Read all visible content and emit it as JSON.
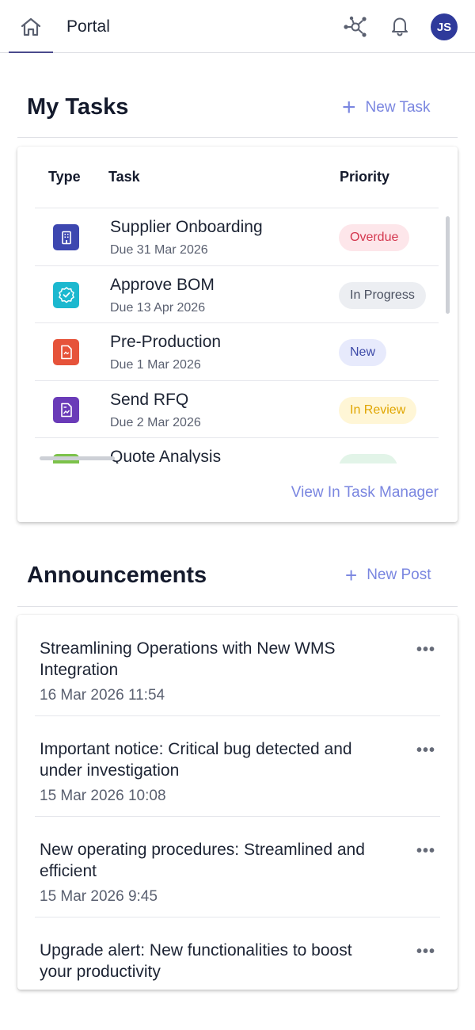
{
  "header": {
    "portal_title": "Portal",
    "avatar_initials": "JS",
    "icons": [
      "home-icon",
      "network-icon",
      "bell-icon"
    ]
  },
  "tasks_section": {
    "title": "My Tasks",
    "new_label": "New Task",
    "columns": {
      "type": "Type",
      "task": "Task",
      "priority": "Priority"
    },
    "rows": [
      {
        "name": "Supplier Onboarding",
        "due": "Due 31 Mar 2026",
        "status": "Overdue",
        "icon": "building-icon",
        "icon_color": "#3d47b0",
        "status_bg": "#fde6ea",
        "status_fg": "#d4374f"
      },
      {
        "name": "Approve BOM",
        "due": "Due 13 Apr 2026",
        "status": "In Progress",
        "icon": "check-badge-icon",
        "icon_color": "#1cb8cf",
        "status_bg": "#eceef2",
        "status_fg": "#4a5060"
      },
      {
        "name": "Pre-Production",
        "due": "Due 1 Mar 2026",
        "status": "New",
        "icon": "document-icon",
        "icon_color": "#e6533a",
        "status_bg": "#e7eafc",
        "status_fg": "#3d4aa8"
      },
      {
        "name": "Send RFQ",
        "due": "Due 2 Mar 2026",
        "status": "In Review",
        "icon": "document-chart-icon",
        "icon_color": "#6a3bb8",
        "status_bg": "#fff6d6",
        "status_fg": "#e0a500"
      },
      {
        "name": "Quote Analysis",
        "due": "",
        "status": "",
        "icon": "chart-icon",
        "icon_color": "#7cc24a",
        "status_bg": "#e2f4e8",
        "status_fg": "#2f8a4e"
      }
    ],
    "view_link": "View In Task Manager"
  },
  "announcements_section": {
    "title": "Announcements",
    "new_label": "New Post",
    "items": [
      {
        "title": "Streamlining Operations with New WMS Integration",
        "date": "16 Mar 2026 11:54"
      },
      {
        "title": "Important notice: Critical bug detected and under investigation",
        "date": "15 Mar 2026 10:08"
      },
      {
        "title": "New operating procedures: Streamlined and efficient",
        "date": "15 Mar 2026 9:45"
      },
      {
        "title": "Upgrade alert: New functionalities to boost your productivity",
        "date": ""
      }
    ]
  }
}
